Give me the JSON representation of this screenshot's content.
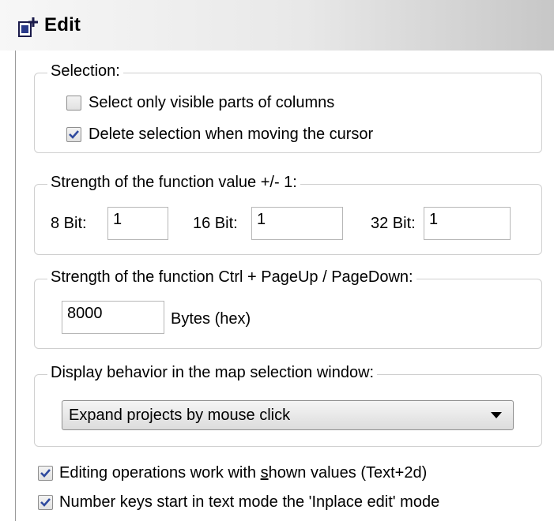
{
  "header": {
    "title": "Edit",
    "icon": "edit-document-icon"
  },
  "selection": {
    "legend": "Selection:",
    "options": [
      {
        "label": "Select only visible parts of columns",
        "checked": false
      },
      {
        "label": "Delete selection when moving the cursor",
        "checked": true
      }
    ]
  },
  "strength": {
    "legend": "Strength of the function value +/- 1:",
    "bit8": {
      "label": "8 Bit:",
      "value": "1"
    },
    "bit16": {
      "label": "16 Bit:",
      "value": "1"
    },
    "bit32": {
      "label": "32 Bit:",
      "value": "1"
    }
  },
  "pageup": {
    "legend": "Strength of the function Ctrl + PageUp / PageDown:",
    "value": "8000",
    "unit": "Bytes (hex)"
  },
  "display": {
    "legend": "Display behavior in the map selection window:",
    "selected": "Expand projects by mouse click"
  },
  "bottom_options": [
    {
      "label_before": "Editing operations work with ",
      "label_ul": "s",
      "label_after": "hown values (Text+2d)",
      "checked": true
    },
    {
      "label": "Number keys start in text mode the 'Inplace edit' mode",
      "checked": true
    }
  ],
  "colors": {
    "check": "#2f4a9e",
    "border": "#cfcfcf"
  }
}
